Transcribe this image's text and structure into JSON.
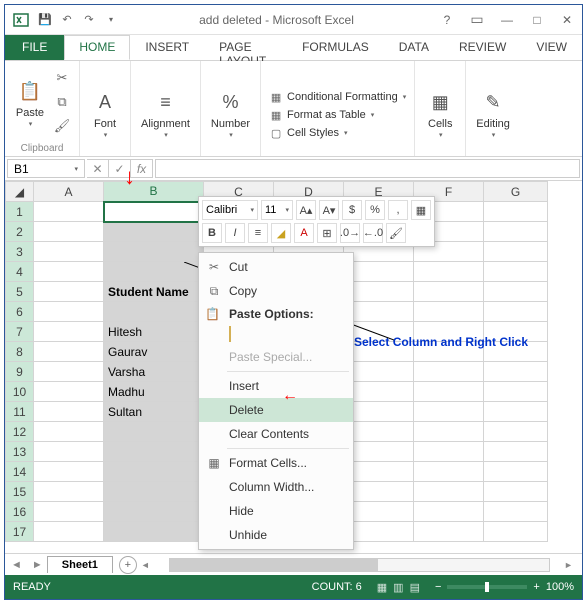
{
  "title": "add deleted - Microsoft Excel",
  "tabs": {
    "file": "FILE",
    "home": "HOME",
    "insert": "INSERT",
    "page": "PAGE LAYOUT",
    "formulas": "FORMULAS",
    "data": "DATA",
    "review": "REVIEW",
    "view": "VIEW"
  },
  "ribbon": {
    "clipboard": {
      "paste": "Paste",
      "label": "Clipboard"
    },
    "font": {
      "label": "Font"
    },
    "alignment": {
      "label": "Alignment"
    },
    "number": {
      "label": "Number"
    },
    "styles": {
      "cf": "Conditional Formatting",
      "ft": "Format as Table",
      "cs": "Cell Styles"
    },
    "cells": {
      "label": "Cells"
    },
    "editing": {
      "label": "Editing"
    }
  },
  "namebox": "B1",
  "columns": [
    "A",
    "B",
    "C",
    "D",
    "E",
    "F",
    "G"
  ],
  "cells": {
    "b5": "Student Name",
    "b7": "Hitesh",
    "b8": "Gaurav",
    "b9": "Varsha",
    "b10": "Madhu",
    "b11": "Sultan"
  },
  "mini": {
    "font": "Calibri",
    "size": "11"
  },
  "context": {
    "cut": "Cut",
    "copy": "Copy",
    "paste_options": "Paste Options:",
    "paste_special": "Paste Special...",
    "insert": "Insert",
    "delete": "Delete",
    "clear": "Clear Contents",
    "format_cells": "Format Cells...",
    "col_width": "Column Width...",
    "hide": "Hide",
    "unhide": "Unhide"
  },
  "annotation": "Select Column and Right Click",
  "sheet_tab": "Sheet1",
  "status": {
    "ready": "READY",
    "count": "COUNT: 6",
    "zoom": "100%"
  }
}
